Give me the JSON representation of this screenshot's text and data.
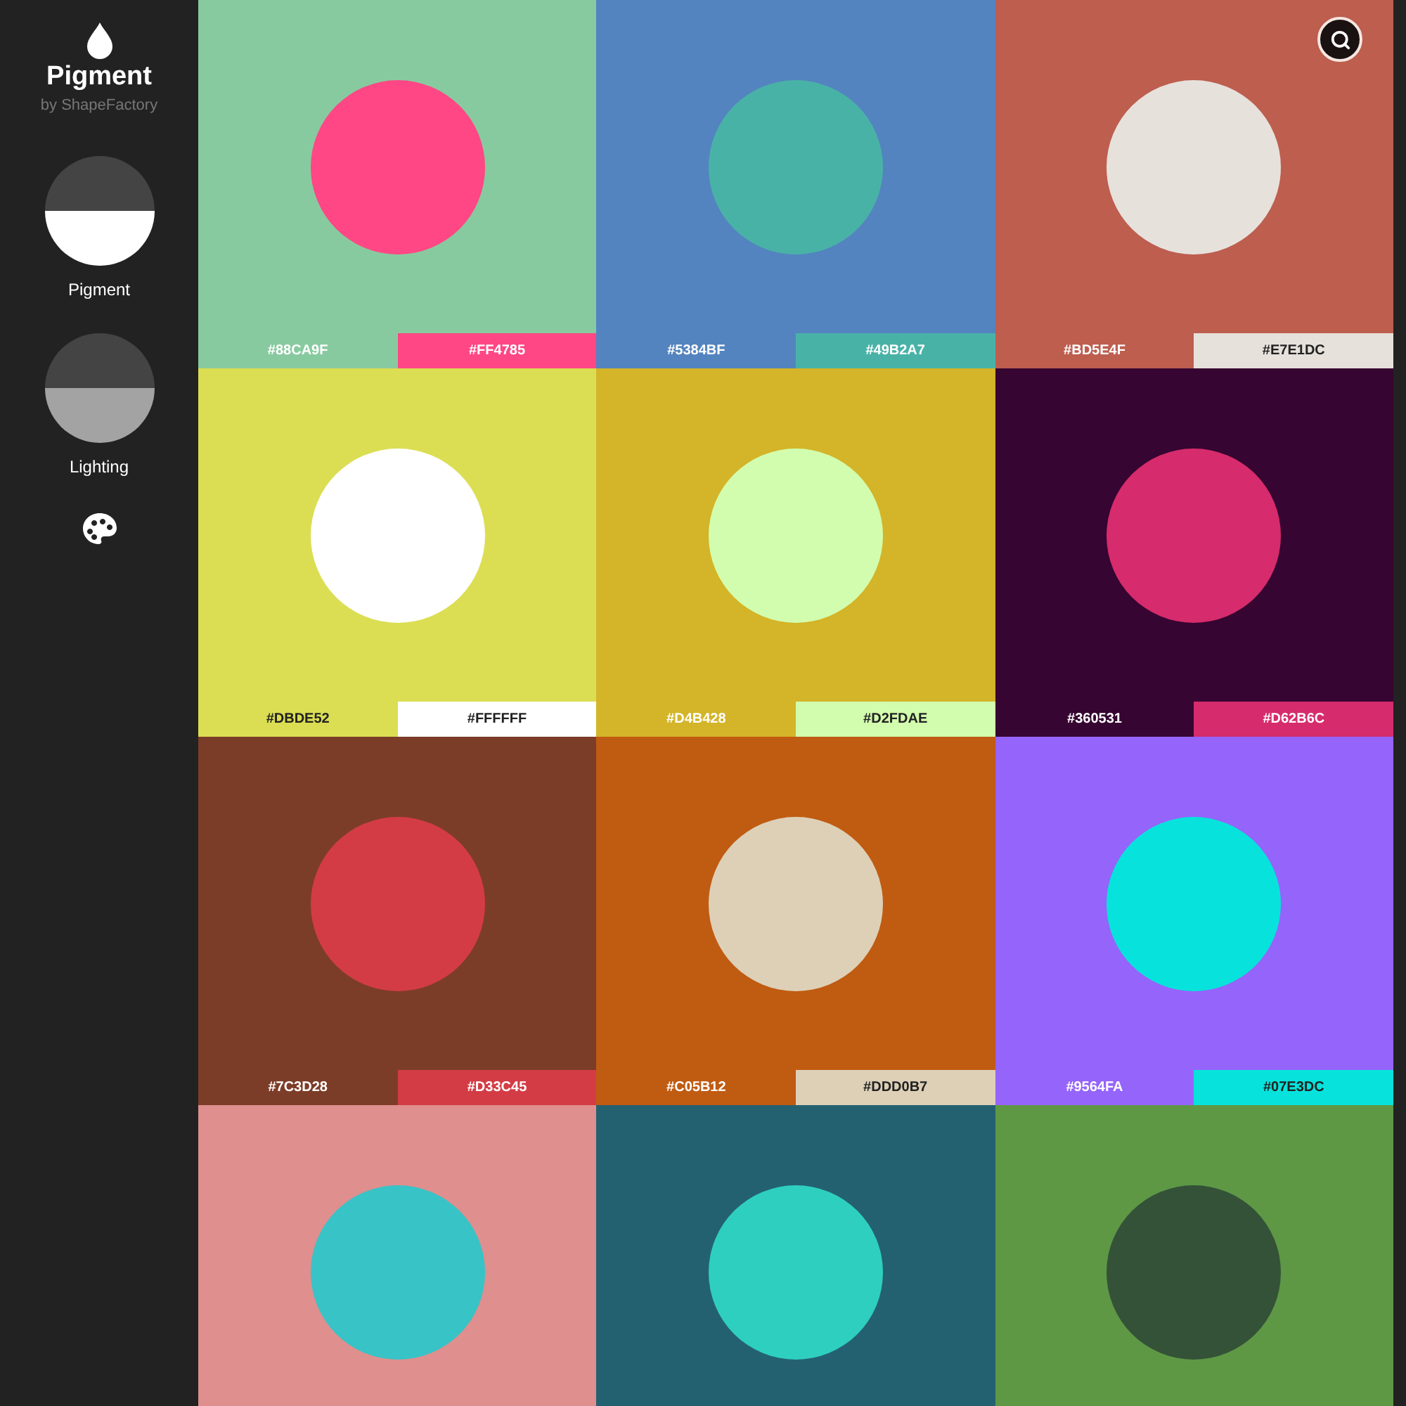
{
  "sidebar": {
    "title": "Pigment",
    "subtitle": "by ShapeFactory",
    "modes": [
      {
        "label": "Pigment",
        "kind": "pigment"
      },
      {
        "label": "Lighting",
        "kind": "lighting"
      }
    ]
  },
  "swatches": [
    {
      "background": {
        "label": "#88CA9F",
        "color": "#88ca9f",
        "dark_text": false
      },
      "accent": {
        "label": "#FF4785",
        "color": "#ff4785",
        "dark_text": false
      }
    },
    {
      "background": {
        "label": "#5384BF",
        "color": "#5384bf",
        "dark_text": false
      },
      "accent": {
        "label": "#49B2A7",
        "color": "#49b2a7",
        "dark_text": false
      }
    },
    {
      "background": {
        "label": "#BD5E4F",
        "color": "#bd5e4f",
        "dark_text": false
      },
      "accent": {
        "label": "#E7E1DC",
        "color": "#e7e1dc",
        "dark_text": true
      }
    },
    {
      "background": {
        "label": "#DBDE52",
        "color": "#dbde52",
        "dark_text": true
      },
      "accent": {
        "label": "#FFFFFF",
        "color": "#ffffff",
        "dark_text": true
      }
    },
    {
      "background": {
        "label": "#D4B428",
        "color": "#d4b428",
        "dark_text": false
      },
      "accent": {
        "label": "#D2FDAE",
        "color": "#d2fdae",
        "dark_text": true
      }
    },
    {
      "background": {
        "label": "#360531",
        "color": "#360531",
        "dark_text": false
      },
      "accent": {
        "label": "#D62B6C",
        "color": "#d62b6c",
        "dark_text": false
      }
    },
    {
      "background": {
        "label": "#7C3D28",
        "color": "#7c3d28",
        "dark_text": false
      },
      "accent": {
        "label": "#D33C45",
        "color": "#d33c45",
        "dark_text": false
      }
    },
    {
      "background": {
        "label": "#C05B12",
        "color": "#c05b12",
        "dark_text": false
      },
      "accent": {
        "label": "#DDD0B7",
        "color": "#ddd0b7",
        "dark_text": true
      }
    },
    {
      "background": {
        "label": "#9564FA",
        "color": "#9564fa",
        "dark_text": false
      },
      "accent": {
        "label": "#07E3DC",
        "color": "#07e3dc",
        "dark_text": true
      }
    },
    {
      "background": {
        "color": "#de8f8e"
      },
      "accent": {
        "color": "#38c3c6"
      }
    },
    {
      "background": {
        "color": "#246170"
      },
      "accent": {
        "color": "#2ecfbf"
      }
    },
    {
      "background": {
        "color": "#5e9845"
      },
      "accent": {
        "color": "#345238"
      }
    }
  ]
}
